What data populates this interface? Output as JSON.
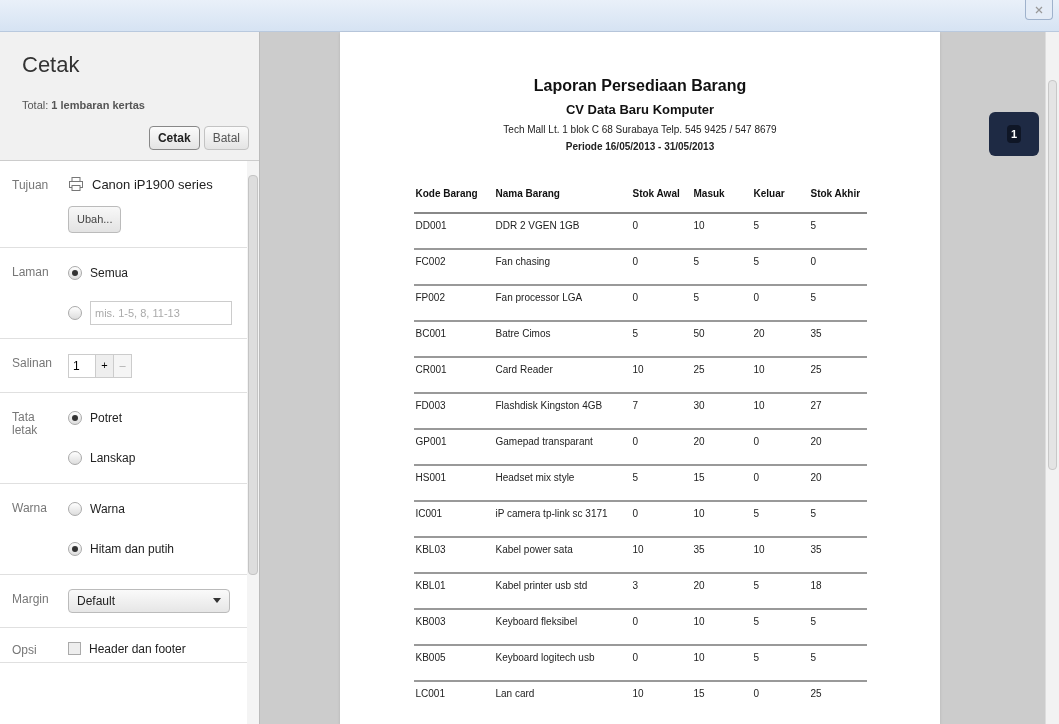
{
  "sidebar": {
    "title": "Cetak",
    "total": "Total: **1 lembaran kertas**",
    "buttons": [
      {
        "label": "Cetak",
        "default": true
      },
      {
        "label": "Batal",
        "default": false
      }
    ],
    "sections": [
      {
        "kind": "destination",
        "label": "Tujuan",
        "printer": "Canon iP1900 series",
        "button": "Ubah..."
      },
      {
        "kind": "radios",
        "label": "Laman",
        "options": [
          {
            "label": "Semua",
            "selected": true
          },
          {
            "placeholder": "mis. 1-5, 8, 11-13",
            "selected": false
          }
        ]
      },
      {
        "kind": "copies",
        "label": "Salinan",
        "value": "1",
        "plus": "+",
        "minus": "–"
      },
      {
        "kind": "radios",
        "label": "Tata letak",
        "options": [
          {
            "label": "Potret",
            "selected": true
          },
          {
            "label": "Lanskap",
            "selected": false
          }
        ]
      },
      {
        "kind": "radios",
        "label": "Warna",
        "options": [
          {
            "label": "Warna",
            "selected": false
          },
          {
            "label": "Hitam dan putih",
            "selected": true
          }
        ]
      },
      {
        "kind": "select",
        "label": "Margin",
        "value": "Default"
      },
      {
        "kind": "checkbox",
        "label": "Opsi",
        "option": "Header dan footer",
        "checked": false
      }
    ]
  },
  "preview": {
    "title": "Laporan Persediaan Barang",
    "company": "CV Data Baru Komputer",
    "address": "Tech Mall Lt. 1 blok C 68 Surabaya Telp. 545 9425 / 547 8679",
    "period": "Periode 16/05/2013 - 31/05/2013",
    "table": {
      "columns": [
        "Kode Barang",
        "Nama Barang",
        "Stok Awal",
        "Masuk",
        "Keluar",
        "Stok Akhir"
      ],
      "rows": [
        [
          "DD001",
          "DDR 2 VGEN 1GB",
          "0",
          "10",
          "5",
          "5"
        ],
        [
          "FC002",
          "Fan chasing",
          "0",
          "5",
          "5",
          "0"
        ],
        [
          "FP002",
          "Fan processor LGA",
          "0",
          "5",
          "0",
          "5"
        ],
        [
          "BC001",
          "Batre Cimos",
          "5",
          "50",
          "20",
          "35"
        ],
        [
          "CR001",
          "Card Reader",
          "10",
          "25",
          "10",
          "25"
        ],
        [
          "FD003",
          "Flashdisk Kingston 4GB",
          "7",
          "30",
          "10",
          "27"
        ],
        [
          "GP001",
          "Gamepad transparant",
          "0",
          "20",
          "0",
          "20"
        ],
        [
          "HS001",
          "Headset mix style",
          "5",
          "15",
          "0",
          "20"
        ],
        [
          "IC001",
          "iP camera tp-link sc 3171",
          "0",
          "10",
          "5",
          "5"
        ],
        [
          "KBL03",
          "Kabel power sata",
          "10",
          "35",
          "10",
          "35"
        ],
        [
          "KBL01",
          "Kabel printer usb std",
          "3",
          "20",
          "5",
          "18"
        ],
        [
          "KB003",
          "Keyboard fleksibel",
          "0",
          "10",
          "5",
          "5"
        ],
        [
          "KB005",
          "Keyboard logitech usb",
          "0",
          "10",
          "5",
          "5"
        ],
        [
          "LC001",
          "Lan card",
          "10",
          "15",
          "0",
          "25"
        ]
      ]
    }
  },
  "page_indicator": "1"
}
